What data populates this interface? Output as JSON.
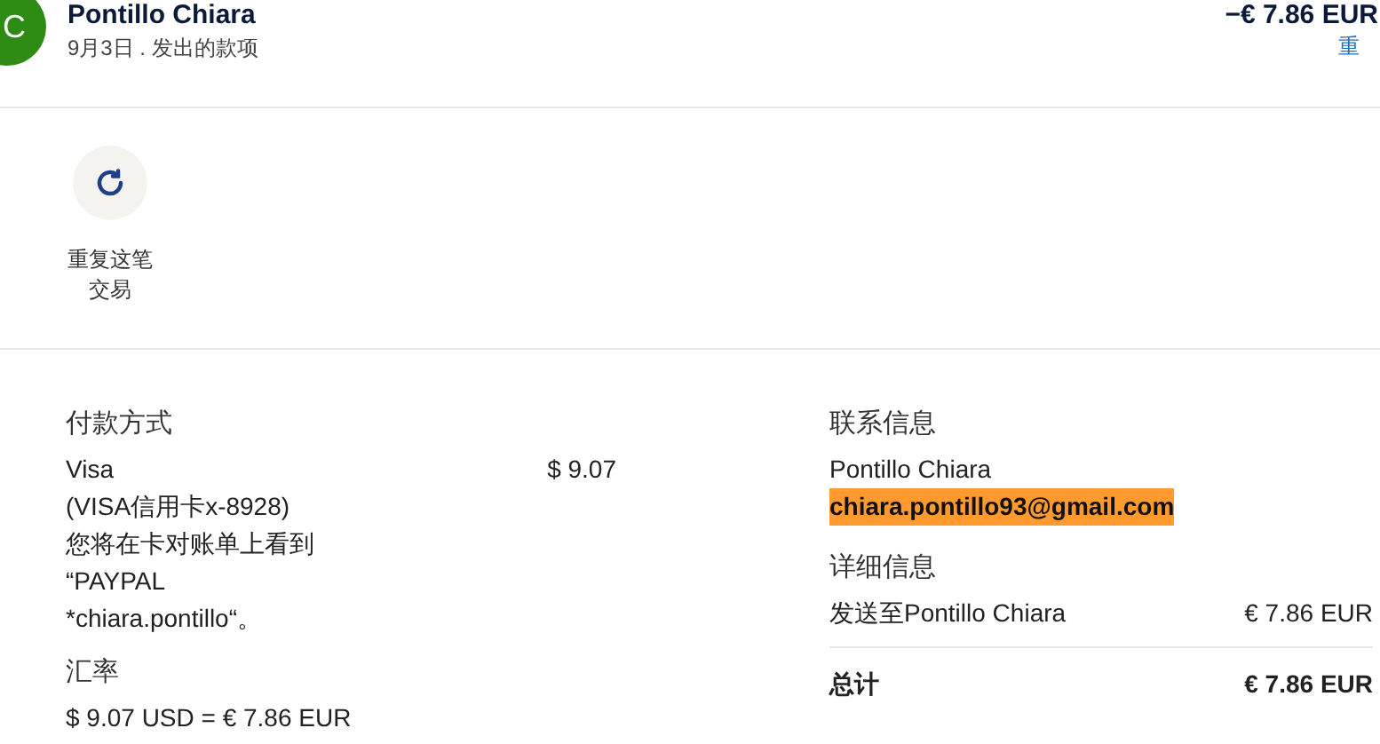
{
  "header": {
    "avatar": "C",
    "name": "Pontillo Chiara",
    "subtitle": "9月3日 . 发出的款项",
    "amount": "−€ 7.86 EUR",
    "link": "重"
  },
  "actions": [
    {
      "label": "重复这笔交易"
    }
  ],
  "payment": {
    "heading": "付款方式",
    "lines": [
      "Visa",
      "(VISA信用卡x-8928)",
      "您将在卡对账单上看到",
      "“PAYPAL",
      "*chiara.pontillo“。"
    ],
    "amount": "$ 9.07"
  },
  "exchange": {
    "heading": "汇率",
    "text": "$ 9.07 USD = € 7.86 EUR"
  },
  "contact": {
    "heading": "联系信息",
    "name": "Pontillo Chiara",
    "email": "chiara.pontillo93@gmail.com",
    "email_highlighted": true
  },
  "details": {
    "heading": "详细信息",
    "rows": [
      {
        "label": "发送至Pontillo Chiara",
        "value": "€ 7.86 EUR",
        "kind": "line"
      },
      {
        "label": "总计",
        "value": "€ 7.86 EUR",
        "kind": "total"
      }
    ]
  }
}
